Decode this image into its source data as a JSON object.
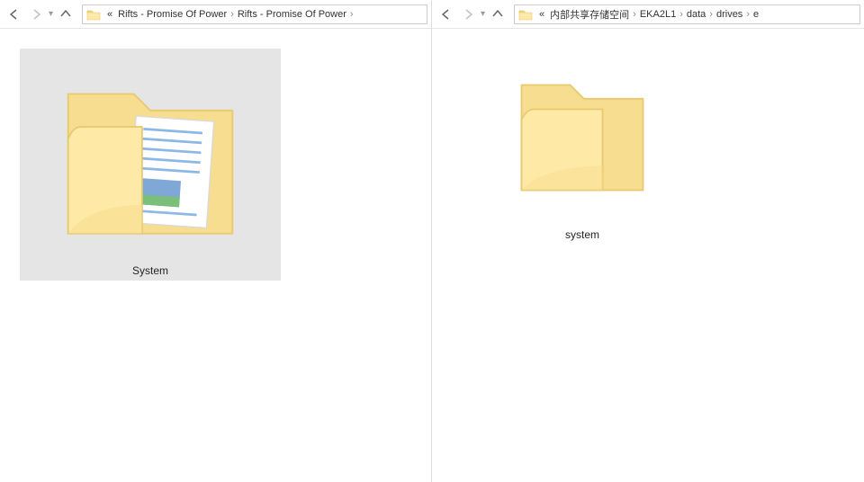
{
  "left": {
    "nav": {
      "back_enabled": true,
      "forward_enabled": false
    },
    "breadcrumb": {
      "overflow": "«",
      "segments": [
        "Rifts - Promise Of Power",
        "Rifts - Promise Of Power"
      ]
    },
    "items": [
      {
        "label": "System",
        "selected": true,
        "has_content": true
      }
    ]
  },
  "right": {
    "nav": {
      "back_enabled": true,
      "forward_enabled": false
    },
    "breadcrumb": {
      "overflow": "«",
      "segments": [
        "内部共享存储空间",
        "EKA2L1",
        "data",
        "drives",
        "e"
      ]
    },
    "items": [
      {
        "label": "system",
        "selected": false,
        "has_content": false
      }
    ]
  }
}
